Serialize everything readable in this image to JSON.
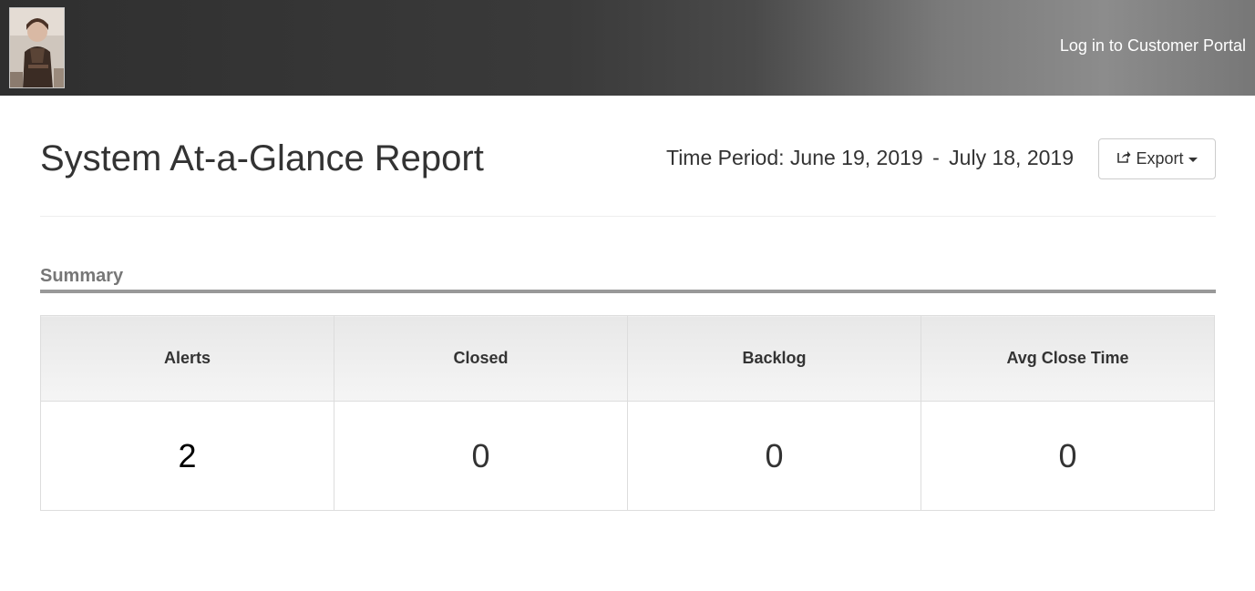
{
  "header": {
    "portal_link": "Log in to Customer Portal",
    "avatar_icon": "user-avatar"
  },
  "report": {
    "title": "System At-a-Glance Report",
    "period_label": "Time Period:",
    "period_start": "June 19, 2019",
    "period_separator": "-",
    "period_end": "July 18, 2019",
    "export_label": "Export",
    "export_icon": "share-square-icon"
  },
  "summary": {
    "title": "Summary",
    "columns": [
      "Alerts",
      "Closed",
      "Backlog",
      "Avg Close Time"
    ],
    "values": [
      "2",
      "0",
      "0",
      "0"
    ]
  },
  "colors": {
    "header_dark": "#2f2f2f",
    "header_light": "#8c8c8c",
    "section_rule": "#999999",
    "text": "#333333"
  }
}
